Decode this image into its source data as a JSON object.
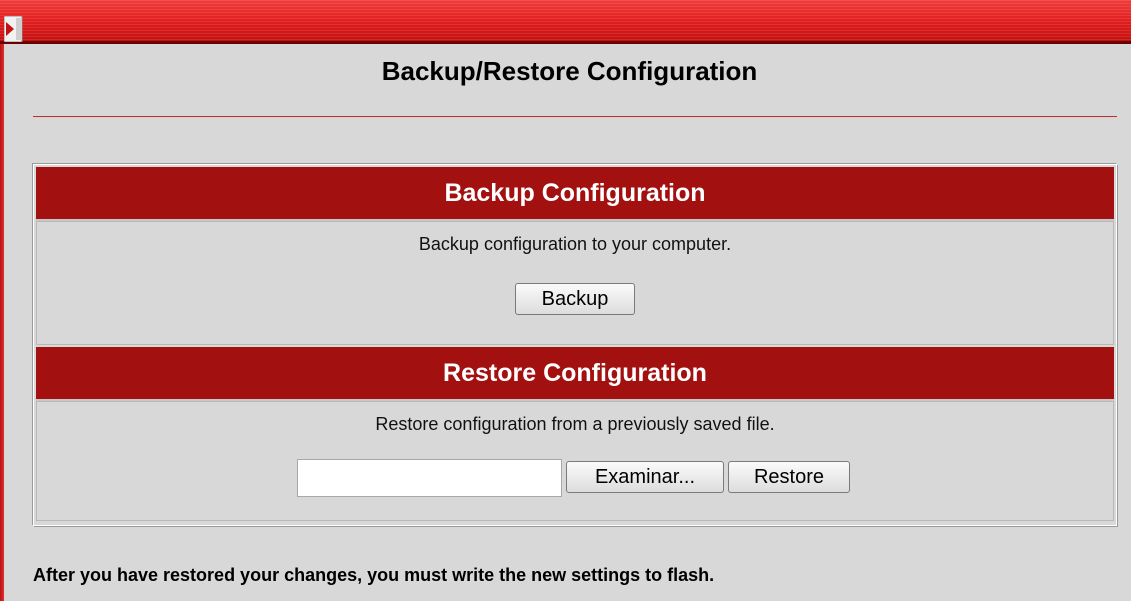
{
  "page": {
    "title": "Backup/Restore Configuration",
    "footer_note": "After you have restored your changes, you must write the new settings to flash."
  },
  "backup": {
    "header": "Backup Configuration",
    "description": "Backup configuration to your computer.",
    "button_label": "Backup"
  },
  "restore": {
    "header": "Restore Configuration",
    "description": "Restore configuration from a previously saved file.",
    "file_value": "",
    "browse_label": "Examinar...",
    "button_label": "Restore"
  },
  "icons": {
    "frame_icon": "frame-toggle-icon"
  },
  "colors": {
    "banner_red": "#e01d1d",
    "header_red": "#a31010",
    "page_bg": "#d8d8d8"
  }
}
